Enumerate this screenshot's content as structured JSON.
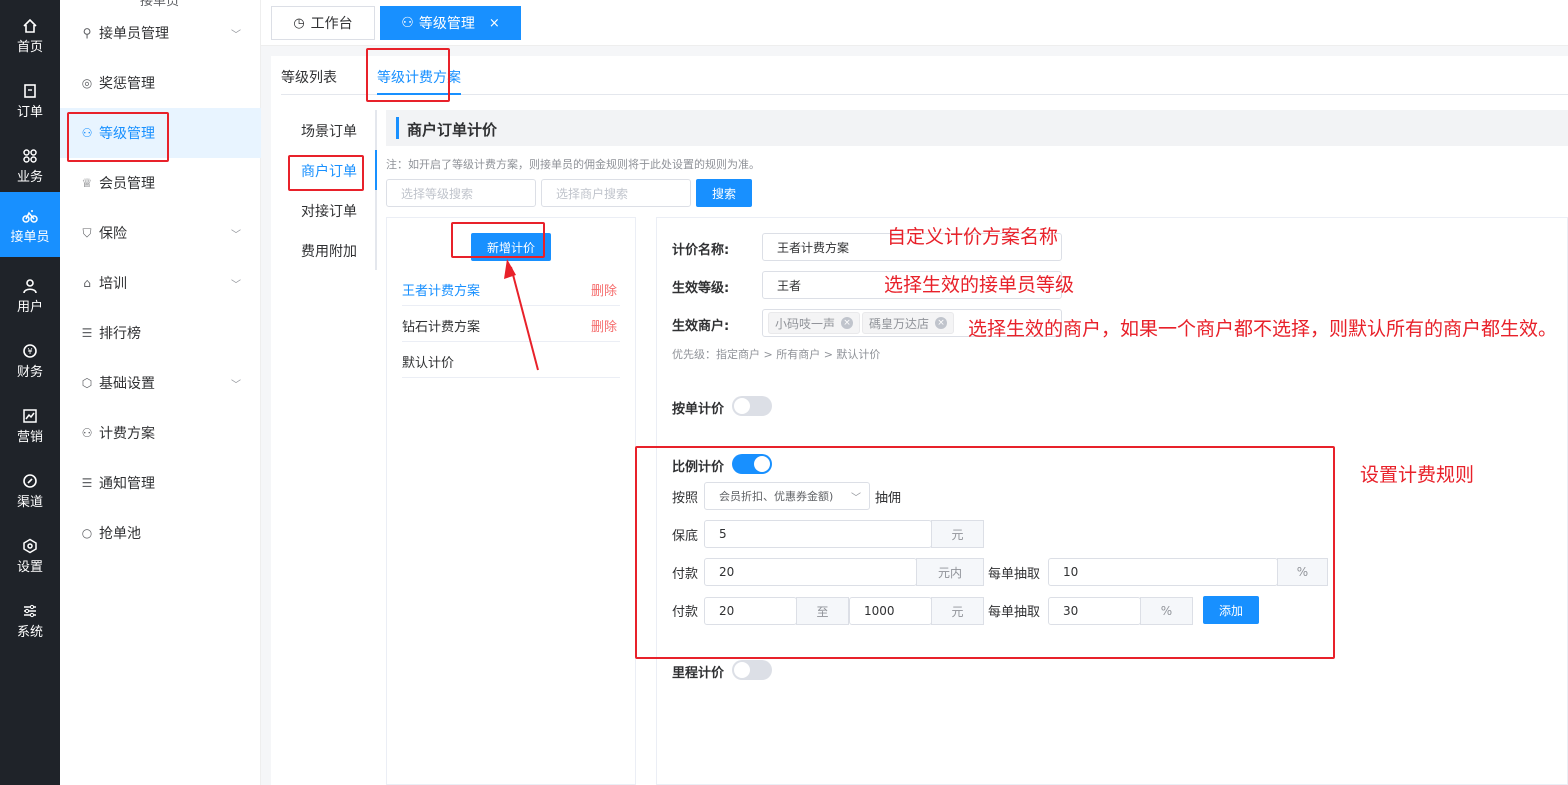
{
  "rail": {
    "items": [
      {
        "label": "首页",
        "icon": "home-icon"
      },
      {
        "label": "订单",
        "icon": "order-icon"
      },
      {
        "label": "业务",
        "icon": "grid-icon"
      },
      {
        "label": "接单员",
        "icon": "bike-icon"
      },
      {
        "label": "用户",
        "icon": "user-icon"
      },
      {
        "label": "财务",
        "icon": "coin-icon"
      },
      {
        "label": "营销",
        "icon": "chart-icon"
      },
      {
        "label": "渠道",
        "icon": "link-icon"
      },
      {
        "label": "设置",
        "icon": "hexagon-icon"
      },
      {
        "label": "系统",
        "icon": "sliders-icon"
      }
    ],
    "active_label": "接单员",
    "active_color": "#1890ff"
  },
  "submenu": {
    "header_partial": "接单员",
    "items": [
      {
        "label": "接单员管理",
        "icon": "bike-icon",
        "chevron": true
      },
      {
        "label": "奖惩管理",
        "icon": "medal-icon",
        "chevron": false
      },
      {
        "label": "等级管理",
        "icon": "user-level-icon",
        "chevron": false
      },
      {
        "label": "会员管理",
        "icon": "vip-icon",
        "chevron": false
      },
      {
        "label": "保险",
        "icon": "shield-icon",
        "chevron": true
      },
      {
        "label": "培训",
        "icon": "school-icon",
        "chevron": true
      },
      {
        "label": "排行榜",
        "icon": "list-icon",
        "chevron": false
      },
      {
        "label": "基础设置",
        "icon": "hexagon-icon",
        "chevron": true
      },
      {
        "label": "计费方案",
        "icon": "user-level-icon",
        "chevron": false
      },
      {
        "label": "通知管理",
        "icon": "list-icon",
        "chevron": false
      },
      {
        "label": "抢单池",
        "icon": "circle-icon",
        "chevron": false
      }
    ]
  },
  "topbar": {
    "tabs": [
      {
        "label": "工作台",
        "icon": "dashboard-icon"
      },
      {
        "label": "等级管理",
        "icon": "user-level-icon",
        "close": "×"
      }
    ]
  },
  "page_tabs": [
    "等级列表",
    "等级计费方案"
  ],
  "side_tabs": [
    "场景订单",
    "商户订单",
    "对接订单",
    "费用附加"
  ],
  "section": {
    "title": "商户订单计价",
    "note": "注：如开启了等级计费方案，则接单员的佣金规则将于此处设置的规则为准。",
    "search_level_placeholder": "选择等级搜索",
    "search_merchant_placeholder": "选择商户搜索",
    "search_button": "搜索"
  },
  "plans": {
    "add_button": "新增计价",
    "items": [
      {
        "name": "王者计费方案",
        "delete": "删除",
        "active": true
      },
      {
        "name": "钻石计费方案",
        "delete": "删除",
        "active": false
      },
      {
        "name": "默认计价",
        "delete": "",
        "active": false
      }
    ]
  },
  "form": {
    "name_label": "计价名称:",
    "name_value": "王者计费方案",
    "level_label": "生效等级:",
    "level_value": "王者",
    "merchant_label": "生效商户:",
    "merchants": [
      "小码吱一声",
      "碼皇万达店"
    ],
    "priority_note": "优先级：指定商户 > 所有商户 > 默认计价",
    "per_order_label": "按单计价",
    "per_order_on": false,
    "ratio_label": "比例计价",
    "ratio_on": true,
    "by_label": "按照",
    "by_select": "会员折扣、优惠券金额)",
    "commission_label": "抽佣",
    "min_label": "保底",
    "min_value": "5",
    "min_unit": "元",
    "pay1_label": "付款",
    "pay1_value": "20",
    "pay1_unit": "元内",
    "pay1_take_label": "每单抽取",
    "pay1_take_value": "10",
    "pay1_take_unit": "%",
    "pay2_label": "付款",
    "pay2_from": "20",
    "pay2_to_label": "至",
    "pay2_to": "1000",
    "pay2_unit": "元",
    "pay2_take_label": "每单抽取",
    "pay2_take_value": "30",
    "pay2_take_unit": "%",
    "add_button": "添加",
    "mileage_label": "里程计价",
    "mileage_on": false
  },
  "annotations": {
    "name_tip": "自定义计价方案名称",
    "level_tip": "选择生效的接单员等级",
    "merchant_tip": "选择生效的商户，如果一个商户都不选择，则默认所有的商户都生效。",
    "rule_tip": "设置计费规则"
  }
}
